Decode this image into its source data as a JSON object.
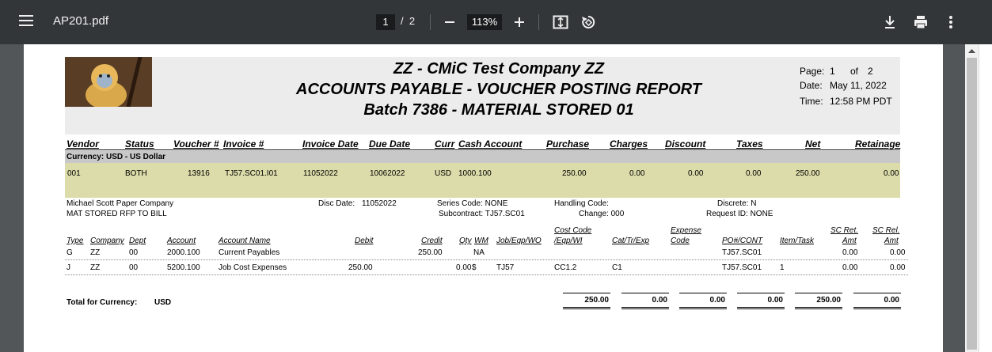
{
  "viewer": {
    "filename": "AP201.pdf",
    "current_page": "1",
    "page_separator": "/",
    "total_pages": "2",
    "zoom": "113%",
    "icons": {
      "menu": "hamburger-menu-icon",
      "zoom_out": "minus-icon",
      "zoom_in": "plus-icon",
      "fit": "fit-page-icon",
      "rotate": "rotate-icon",
      "download": "download-icon",
      "print": "print-icon",
      "more": "more-vert-icon"
    }
  },
  "report": {
    "company": "ZZ - CMiC Test Company ZZ",
    "report_title": "ACCOUNTS PAYABLE - VOUCHER POSTING REPORT",
    "batch": "Batch 7386 - MATERIAL STORED 01",
    "page_label": "Page:",
    "page_num": "1",
    "of_label": "of",
    "page_total": "2",
    "date_label": "Date:",
    "date_value": "May 11, 2022",
    "time_label": "Time:",
    "time_value": "12:58 PM PDT",
    "header_columns": [
      "Vendor",
      "Status",
      "Voucher #",
      "Invoice #",
      "Invoice Date",
      "Due Date",
      "Curr",
      "Cash Account",
      "Purchase",
      "Charges",
      "Discount",
      "Taxes",
      "Net",
      "Retainage"
    ],
    "currency_band": "Currency: USD - US Dollar",
    "voucher": {
      "vendor": "001",
      "status": "BOTH",
      "voucher_no": "13916",
      "invoice_no": "TJ57.SC01.I01",
      "invoice_date": "11052022",
      "due_date": "10062022",
      "curr": "USD",
      "cash_account": "1000.100",
      "purchase": "250.00",
      "charges": "0.00",
      "discount": "0.00",
      "taxes": "0.00",
      "net": "250.00",
      "retainage": "0.00"
    },
    "details": {
      "vendor_name": "Michael Scott Paper Company",
      "description": "MAT STORED RFP TO BILL",
      "disc_date_label": "Disc Date:",
      "disc_date": "11052022",
      "series_code": "Series Code: NONE",
      "subcontract": "Subcontract: TJ57.SC01",
      "handling_code": "Handling Code:",
      "change": "Change: 000",
      "discrete": "Discrete: N",
      "request_id": "Request ID: NONE"
    },
    "dist_headers": {
      "type": "Type",
      "company": "Company",
      "dept": "Dept",
      "account": "Account",
      "account_name": "Account Name",
      "debit": "Debit",
      "credit": "Credit",
      "qty": "Qty",
      "wm": "WM",
      "job": "Job/Eqp/WO",
      "cost_code_1": "Cost Code",
      "cost_code_2": "/Eqp/WI",
      "cat": "Cat/Tr/Exp",
      "expense_1": "Expense",
      "expense_2": "Code",
      "po": "PO#/CONT",
      "item": "Item/Task",
      "scret_1": "SC Ret.",
      "scret_2": "Amt",
      "screl_1": "SC Rel.",
      "screl_2": "Amt"
    },
    "dist_rows": [
      {
        "type": "G",
        "company": "ZZ",
        "dept": "00",
        "account": "2000.100",
        "account_name": "Current Payables",
        "debit": "",
        "credit": "250.00",
        "qty": "",
        "wm": "NA",
        "job": "",
        "cost_code": "",
        "cat": "",
        "expense": "",
        "po": "TJ57.SC01",
        "item": "",
        "scret": "0.00",
        "screl": "0.00"
      },
      {
        "type": "J",
        "company": "ZZ",
        "dept": "00",
        "account": "5200.100",
        "account_name": "Job Cost Expenses",
        "debit": "250.00",
        "credit": "",
        "qty": "0.00",
        "wm": "$",
        "job": "TJ57",
        "cost_code": "CC1.2",
        "cat": "C1",
        "expense": "",
        "po": "TJ57.SC01",
        "item": "1",
        "scret": "0.00",
        "screl": "0.00"
      }
    ],
    "totals": {
      "label": "Total for Currency:",
      "currency": "USD",
      "values": [
        "250.00",
        "0.00",
        "0.00",
        "0.00",
        "250.00",
        "0.00"
      ]
    }
  },
  "colors": {
    "toolbar": "#323639",
    "viewer_bg": "#525659",
    "header_band": "#ececec",
    "currency_band": "#c8c8c8",
    "voucher_band": "#dcdcaa"
  }
}
